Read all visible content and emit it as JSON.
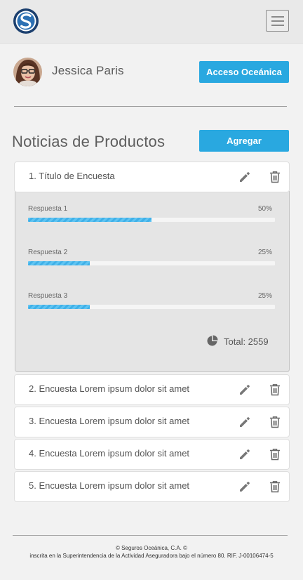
{
  "header": {
    "logo_icon": "seguros-oceanica-logo",
    "menu_icon": "hamburger-menu-icon"
  },
  "profile": {
    "name": "Jessica Paris",
    "access_button": "Acceso Oceánica"
  },
  "section": {
    "title": "Noticias de Productos",
    "add_button": "Agregar"
  },
  "survey_open": {
    "title": "1. Título de Encuesta",
    "answers": [
      {
        "label": "Respuesta 1",
        "percent_text": "50%",
        "value": 50
      },
      {
        "label": "Respuesta 2",
        "percent_text": "25%",
        "value": 25
      },
      {
        "label": "Respuesta 3",
        "percent_text": "25%",
        "value": 25
      }
    ],
    "total": "Total: 2559"
  },
  "surveys": [
    {
      "title": "2. Encuesta Lorem ipsum dolor sit amet"
    },
    {
      "title": "3. Encuesta Lorem ipsum dolor sit amet"
    },
    {
      "title": "4. Encuesta Lorem ipsum dolor sit amet"
    },
    {
      "title": "5. Encuesta Lorem ipsum dolor sit amet"
    }
  ],
  "footer": {
    "line1": "© Seguros Oceánica, C.A. ©",
    "line2": "inscrita en la Superintendencia de la Actividad Aseguradora bajo el número 80. RIF. J-00106474-5"
  },
  "colors": {
    "accent": "#29a8e0",
    "bar": "#4fb9ec",
    "background": "#f2f2f2"
  }
}
